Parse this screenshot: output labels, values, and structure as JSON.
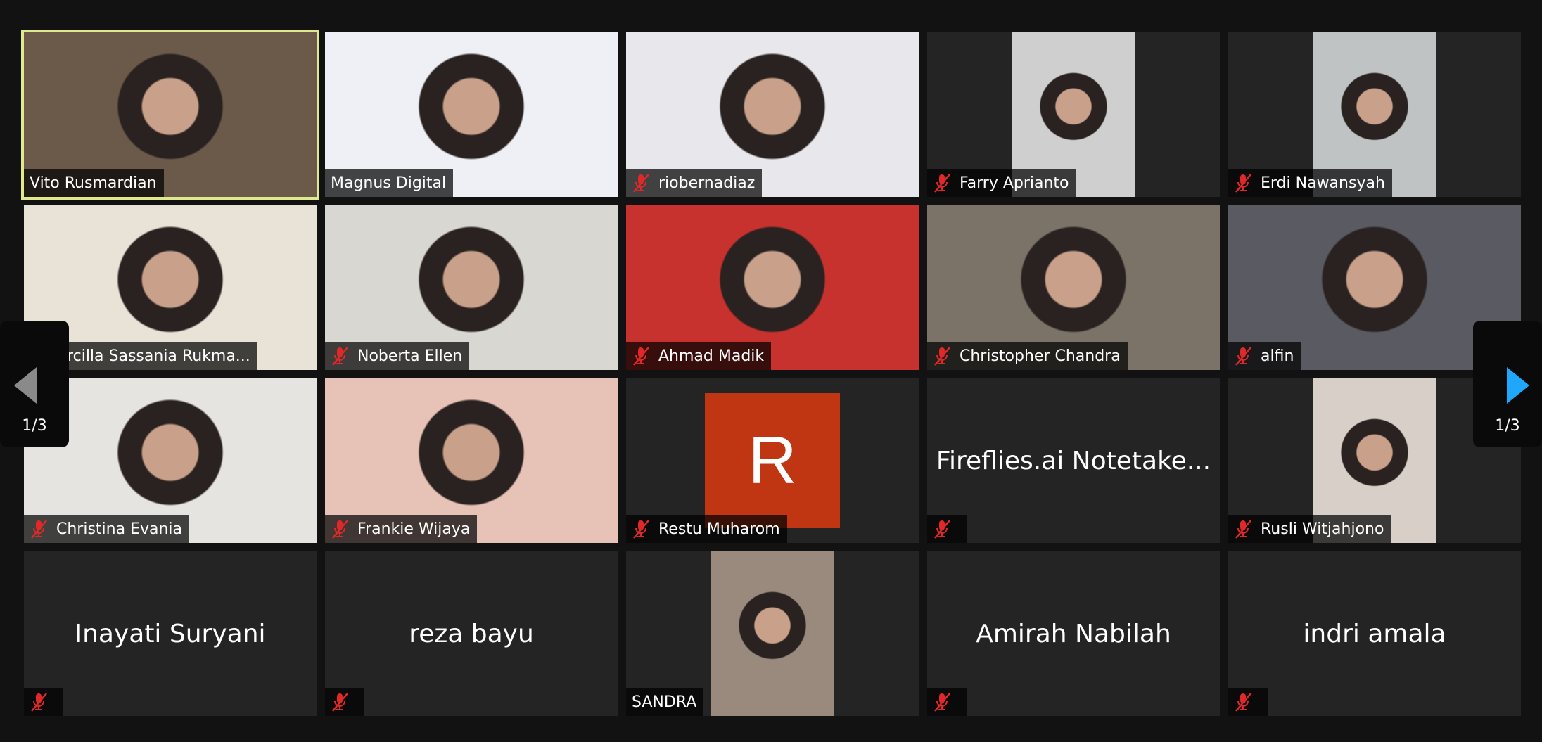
{
  "gallery": {
    "participants": [
      {
        "name": "Vito Rusmardian",
        "muted": false,
        "video": true,
        "active": true,
        "bg": "#6b5a4a",
        "pillar": false
      },
      {
        "name": "Magnus Digital",
        "muted": false,
        "video": true,
        "bg": "#eef0f5",
        "pillar": false
      },
      {
        "name": "riobernadiaz",
        "muted": true,
        "video": true,
        "bg": "#e8e8ec",
        "pillar": false
      },
      {
        "name": "Farry Aprianto",
        "muted": true,
        "video": true,
        "bg": "#cfcfcf",
        "pillar": true
      },
      {
        "name": "Erdi Nawansyah",
        "muted": true,
        "video": true,
        "bg": "#bfc3c4",
        "pillar": true
      },
      {
        "name": "Arcilla Sassania Rukma...",
        "muted": true,
        "video": true,
        "bg": "#e9e2d6",
        "pillar": false
      },
      {
        "name": "Noberta Ellen",
        "muted": true,
        "video": true,
        "bg": "#d9d7d2",
        "pillar": false
      },
      {
        "name": "Ahmad Madik",
        "muted": true,
        "video": true,
        "bg": "#c8322e",
        "pillar": false
      },
      {
        "name": "Christopher Chandra",
        "muted": true,
        "video": true,
        "bg": "#7b7268",
        "pillar": false
      },
      {
        "name": "alfin",
        "muted": true,
        "video": true,
        "bg": "#595a62",
        "pillar": false
      },
      {
        "name": "Christina Evania",
        "muted": true,
        "video": true,
        "bg": "#e6e4e0",
        "pillar": false
      },
      {
        "name": "Frankie Wijaya",
        "muted": true,
        "video": true,
        "bg": "#e7c2b6",
        "pillar": false
      },
      {
        "name": "Restu Muharom",
        "muted": true,
        "video": false,
        "avatar": "R"
      },
      {
        "name": "Fireflies.ai Notetake...",
        "muted": true,
        "video": false,
        "center": true,
        "hide_label_name": true
      },
      {
        "name": "Rusli Witjahjono",
        "muted": true,
        "video": true,
        "bg": "#d8cfc8",
        "pillar": true
      },
      {
        "name": "Inayati Suryani",
        "muted": true,
        "video": false,
        "center": true,
        "hide_label_name": true
      },
      {
        "name": "reza bayu",
        "muted": true,
        "video": false,
        "center": true,
        "hide_label_name": true
      },
      {
        "name": "SANDRA",
        "muted": false,
        "video": true,
        "bg": "#9a8a7e",
        "pillar": true
      },
      {
        "name": "Amirah Nabilah",
        "muted": true,
        "video": false,
        "center": true,
        "hide_label_name": true
      },
      {
        "name": "indri amala",
        "muted": true,
        "video": false,
        "center": true,
        "hide_label_name": true
      }
    ]
  },
  "pagination": {
    "prev_page_label": "1/3",
    "next_page_label": "1/3"
  },
  "colors": {
    "active_speaker": "#dfe88a",
    "muted_icon": "#e02828",
    "avatar": "#c13612",
    "next_arrow": "#1ea7fd",
    "prev_arrow": "#8a8a8a"
  }
}
